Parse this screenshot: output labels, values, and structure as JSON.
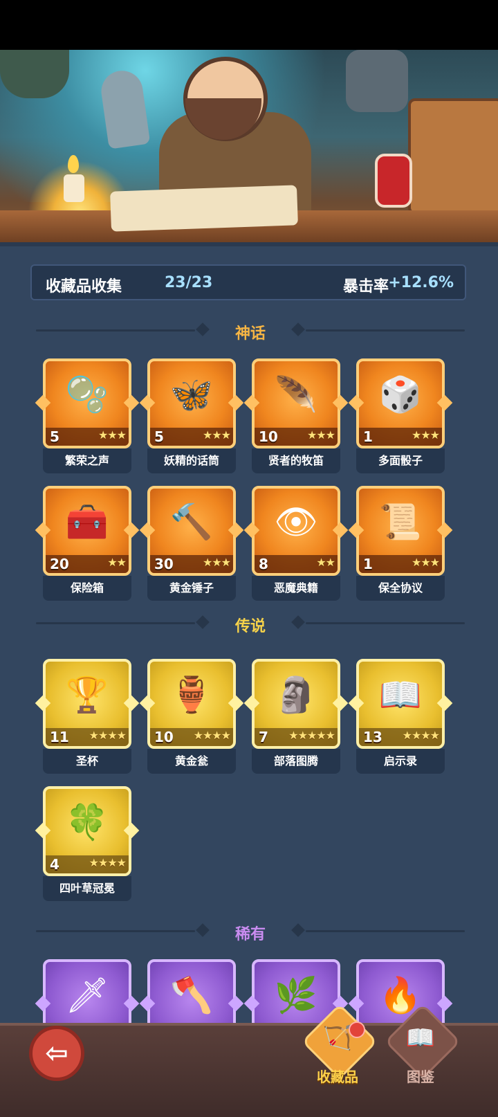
{
  "summary": {
    "collection_label": "收藏品收集",
    "collection_count": "23/23",
    "crit_label": "暴击率",
    "crit_value": "+12.6%"
  },
  "sections": {
    "mythic": {
      "label": "神话",
      "color": "#f6b544"
    },
    "legendary": {
      "label": "传说",
      "color": "#f6d24a"
    },
    "rare": {
      "label": "稀有",
      "color": "#c98cf0"
    }
  },
  "mythic_items": [
    {
      "name": "繁荣之声",
      "count": "5",
      "stars": "★★★",
      "icon": "bubble-icon"
    },
    {
      "name": "妖精的话筒",
      "count": "5",
      "stars": "★★★",
      "icon": "fairy-microphone-icon"
    },
    {
      "name": "贤者的牧笛",
      "count": "10",
      "stars": "★★★",
      "icon": "flute-icon"
    },
    {
      "name": "多面骰子",
      "count": "1",
      "stars": "★★★",
      "icon": "dice-icon"
    },
    {
      "name": "保险箱",
      "count": "20",
      "stars": "★★",
      "icon": "safe-chest-icon"
    },
    {
      "name": "黄金锤子",
      "count": "30",
      "stars": "★★★",
      "icon": "hammer-icon"
    },
    {
      "name": "恶魔典籍",
      "count": "8",
      "stars": "★★",
      "icon": "demon-book-icon"
    },
    {
      "name": "保全协议",
      "count": "1",
      "stars": "★★★",
      "icon": "contract-icon"
    }
  ],
  "legendary_items": [
    {
      "name": "圣杯",
      "count": "11",
      "stars": "★★★★",
      "icon": "grail-icon"
    },
    {
      "name": "黄金瓮",
      "count": "10",
      "stars": "★★★★",
      "icon": "golden-urn-icon"
    },
    {
      "name": "部落图腾",
      "count": "7",
      "stars": "★★★★★",
      "icon": "totem-icon"
    },
    {
      "name": "启示录",
      "count": "13",
      "stars": "★★★★",
      "icon": "open-book-icon"
    },
    {
      "name": "四叶草冠冕",
      "count": "4",
      "stars": "★★★★",
      "icon": "clover-crown-icon"
    }
  ],
  "rare_items": [
    {
      "icon": "frost-dagger-icon"
    },
    {
      "icon": "axe-icon"
    },
    {
      "icon": "vine-icon"
    },
    {
      "icon": "flame-feather-icon"
    }
  ],
  "nav": {
    "collection_label": "收藏品",
    "codex_label": "图鉴"
  }
}
